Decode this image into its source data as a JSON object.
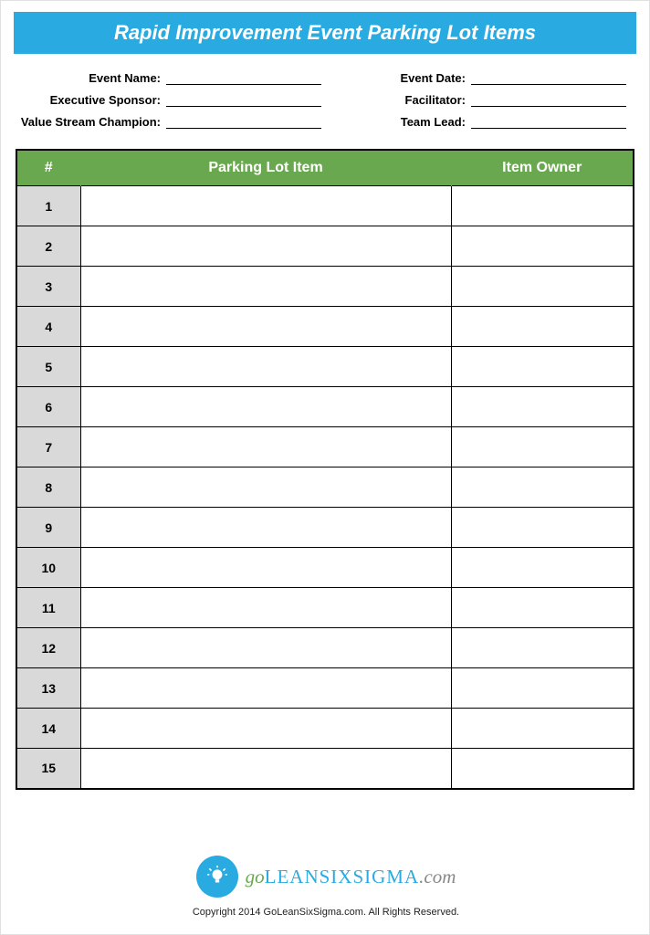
{
  "title": "Rapid Improvement Event Parking Lot Items",
  "info": {
    "left": [
      {
        "label": "Event Name:",
        "value": ""
      },
      {
        "label": "Executive Sponsor:",
        "value": ""
      },
      {
        "label": "Value Stream Champion:",
        "value": ""
      }
    ],
    "right": [
      {
        "label": "Event Date:",
        "value": ""
      },
      {
        "label": "Facilitator:",
        "value": ""
      },
      {
        "label": "Team Lead:",
        "value": ""
      }
    ]
  },
  "table": {
    "headers": {
      "num": "#",
      "item": "Parking Lot Item",
      "owner": "Item Owner"
    },
    "rows": [
      {
        "num": "1",
        "item": "",
        "owner": ""
      },
      {
        "num": "2",
        "item": "",
        "owner": ""
      },
      {
        "num": "3",
        "item": "",
        "owner": ""
      },
      {
        "num": "4",
        "item": "",
        "owner": ""
      },
      {
        "num": "5",
        "item": "",
        "owner": ""
      },
      {
        "num": "6",
        "item": "",
        "owner": ""
      },
      {
        "num": "7",
        "item": "",
        "owner": ""
      },
      {
        "num": "8",
        "item": "",
        "owner": ""
      },
      {
        "num": "9",
        "item": "",
        "owner": ""
      },
      {
        "num": "10",
        "item": "",
        "owner": ""
      },
      {
        "num": "11",
        "item": "",
        "owner": ""
      },
      {
        "num": "12",
        "item": "",
        "owner": ""
      },
      {
        "num": "13",
        "item": "",
        "owner": ""
      },
      {
        "num": "14",
        "item": "",
        "owner": ""
      },
      {
        "num": "15",
        "item": "",
        "owner": ""
      }
    ]
  },
  "logo": {
    "go": "go",
    "lean": "LEANSIXSIGMA",
    "dom": ".com"
  },
  "copyright": "Copyright 2014 GoLeanSixSigma.com. All Rights Reserved."
}
